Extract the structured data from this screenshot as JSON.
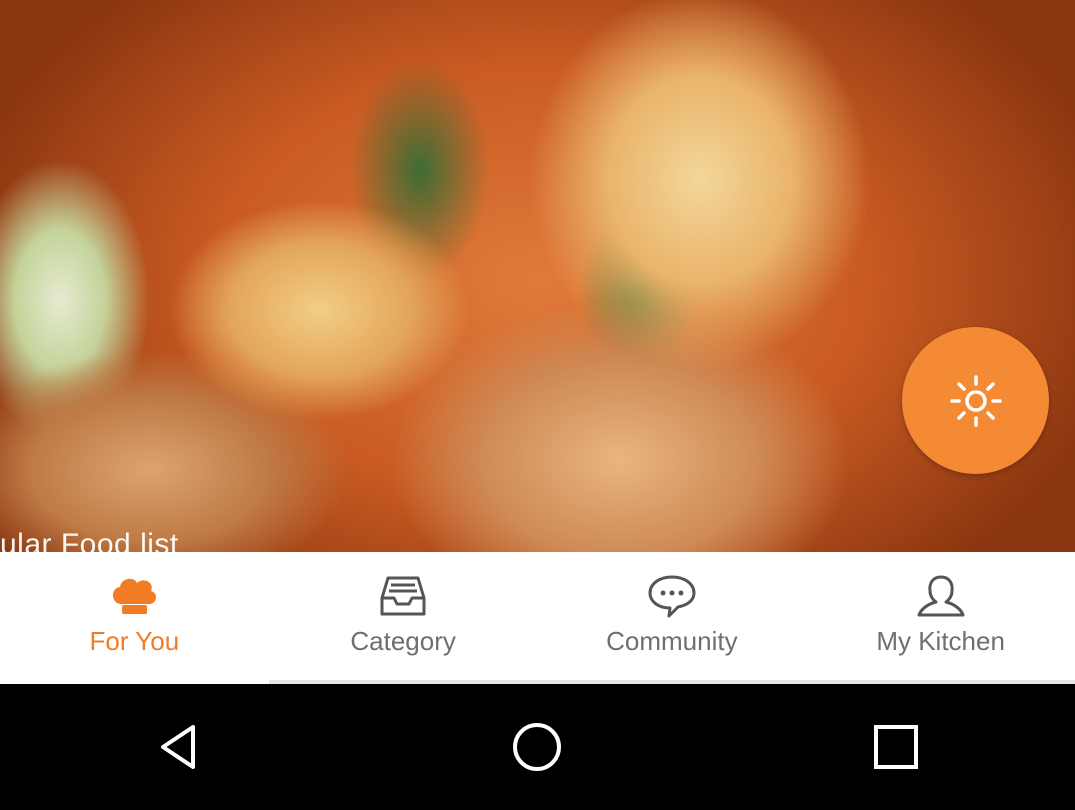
{
  "hero": {
    "caption": "ular Food list"
  },
  "fab": {
    "icon": "brightness-icon",
    "color": "#f58a34"
  },
  "bottom_nav": {
    "accent_color": "#f27b26",
    "tabs": [
      {
        "label": "For You",
        "icon": "chef-hat-icon",
        "active": true
      },
      {
        "label": "Category",
        "icon": "tray-icon",
        "active": false
      },
      {
        "label": "Community",
        "icon": "chat-bubble-icon",
        "active": false
      },
      {
        "label": "My Kitchen",
        "icon": "person-icon",
        "active": false
      }
    ]
  },
  "system_nav": {
    "buttons": [
      "back-icon",
      "home-icon",
      "recents-icon"
    ]
  }
}
